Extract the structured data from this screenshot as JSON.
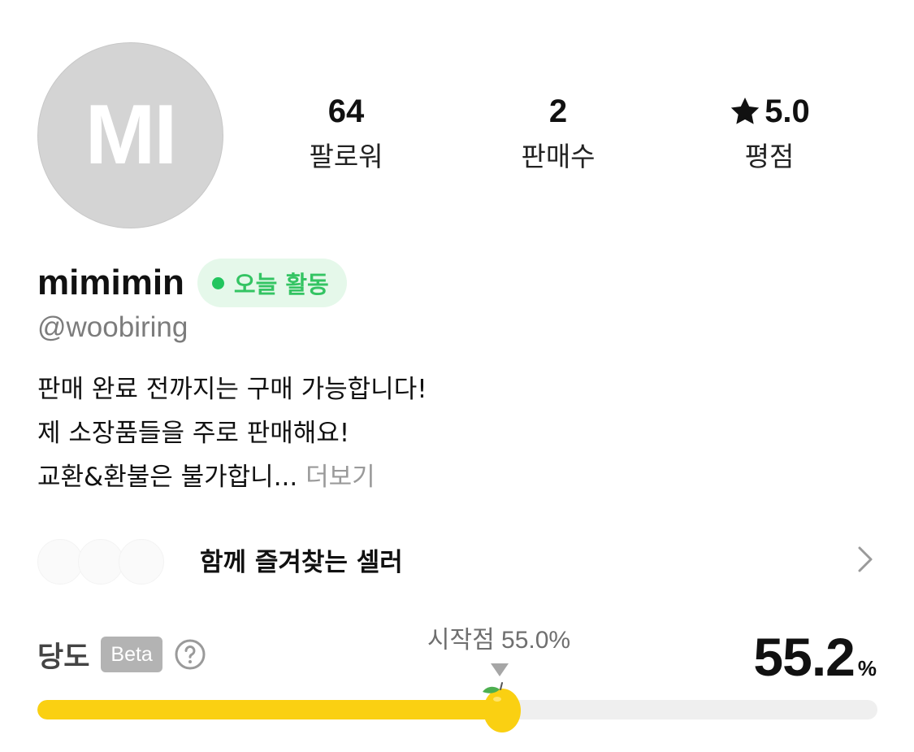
{
  "profile": {
    "avatar_initials": "MI",
    "username": "mimimin",
    "active_badge": "오늘 활동",
    "handle": "@woobiring",
    "bio_lines": [
      "판매 완료 전까지는 구매 가능합니다!",
      "제 소장품들을 주로 판매해요!",
      "교환&환불은 불가합니..."
    ],
    "bio_more": "더보기"
  },
  "stats": [
    {
      "value": "64",
      "label": "팔로워"
    },
    {
      "value": "2",
      "label": "판매수"
    },
    {
      "value": "5.0",
      "label": "평점",
      "icon": "star-icon"
    }
  ],
  "together_sellers": {
    "label": "함께 즐겨찾는 셀러",
    "icon": "chevron-right-icon"
  },
  "sugar": {
    "title": "당도",
    "beta": "Beta",
    "help_icon": "help-circle-icon",
    "start_label": "시작점 55.0%",
    "start_percent": 55.0,
    "value": "55.2",
    "unit": "%",
    "percent": 55.2,
    "marker_icon": "lemon-icon"
  },
  "colors": {
    "active_green": "#34c463",
    "sugar_yellow": "#fad012",
    "track_gray": "#efefef"
  }
}
